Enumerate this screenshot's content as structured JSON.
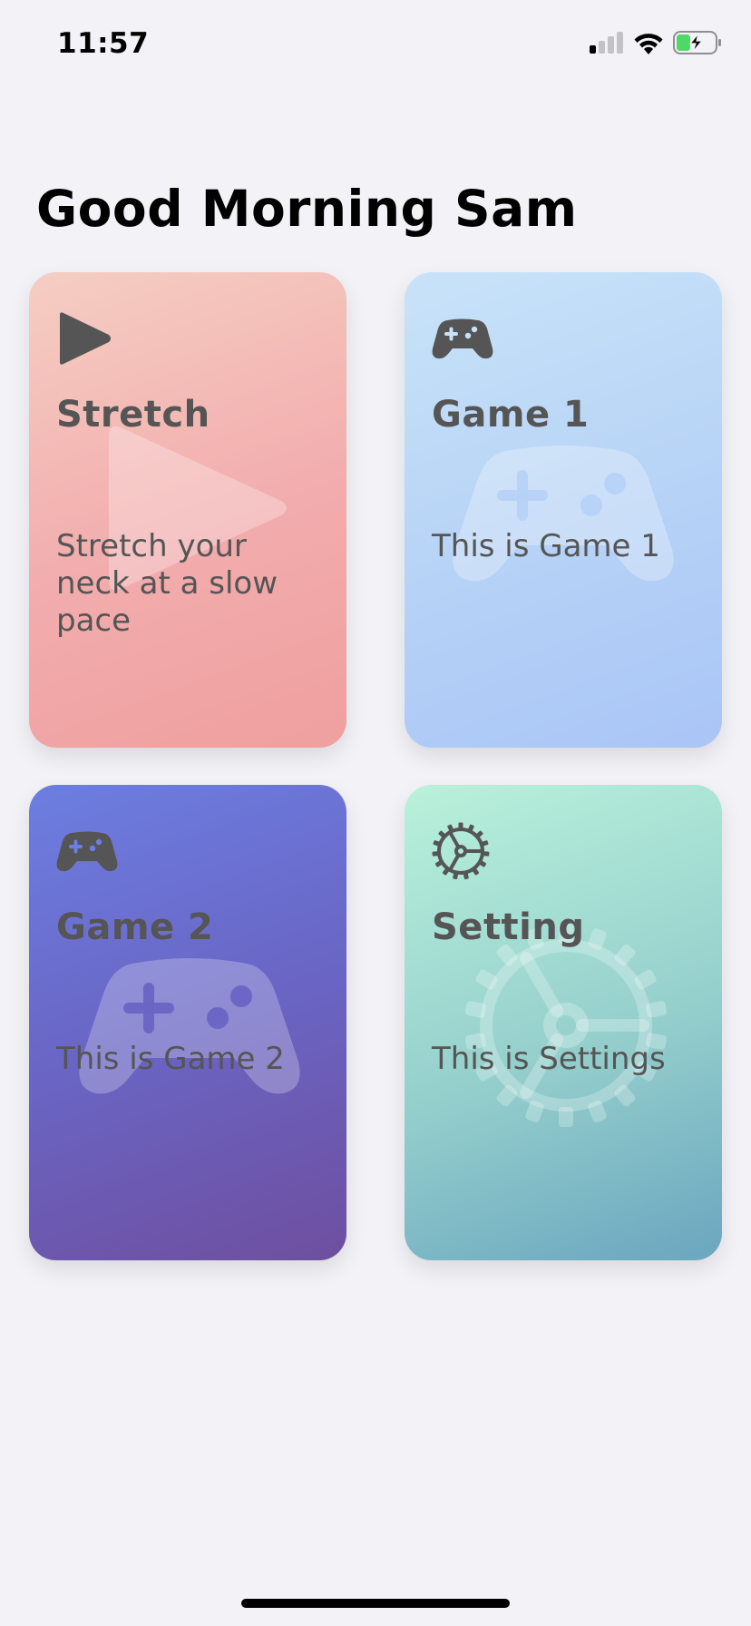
{
  "status_bar": {
    "time": "11:57",
    "signal_icon": "cellular-signal-icon",
    "wifi_icon": "wifi-icon",
    "battery_icon": "battery-charging-icon"
  },
  "greeting": "Good Morning Sam",
  "cards": [
    {
      "title": "Stretch",
      "description": "Stretch your neck at a slow pace",
      "icon": "play-icon"
    },
    {
      "title": "Game 1",
      "description": "This is Game 1",
      "icon": "gamepad-icon"
    },
    {
      "title": "Game 2",
      "description": "This is Game 2",
      "icon": "gamepad-icon"
    },
    {
      "title": "Setting",
      "description": "This is Settings",
      "icon": "settings-wheel-icon"
    }
  ],
  "colors": {
    "background": "#f2f2f7",
    "card_text": "#555555",
    "battery_fill": "#4cd964"
  }
}
